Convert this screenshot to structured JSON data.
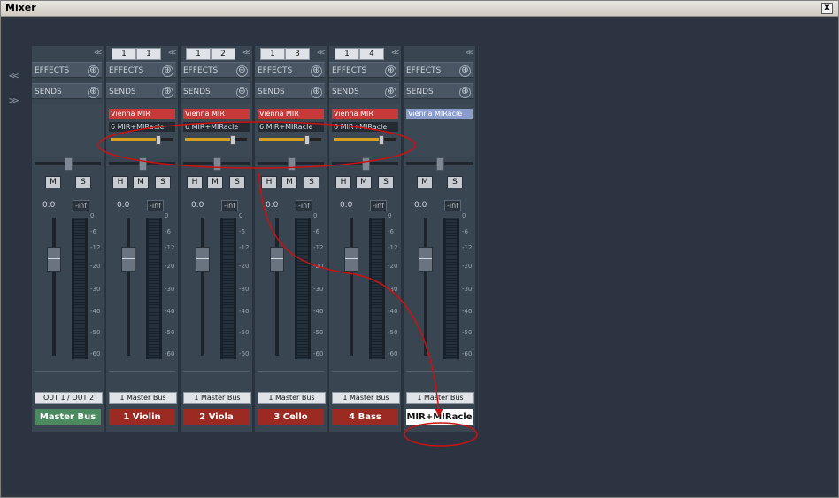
{
  "window": {
    "title": "Mixer",
    "close_label": "x"
  },
  "nav": {
    "collapse_left": "<<",
    "expand_right": ">>"
  },
  "labels": {
    "effects": "EFFECTS",
    "sends": "SENDS",
    "plus": "⊕",
    "collapse": "<<"
  },
  "buttons": {
    "h": "H",
    "m": "M",
    "s": "S"
  },
  "meter_ticks": [
    "0",
    "-6",
    "-12",
    "-20",
    "-30",
    "-40",
    "-50",
    "-60"
  ],
  "strips": [
    {
      "name": "Master Bus",
      "color": "#4a8a5e",
      "io": [],
      "volume": "0.0",
      "peak": "-inf",
      "route": "OUT 1 / OUT 2",
      "inserts": [],
      "has_h": false,
      "send_level": null
    },
    {
      "name": "1 Violin",
      "color": "#9a2a22",
      "io": [
        "1",
        "1"
      ],
      "volume": "0.0",
      "peak": "-inf",
      "route": "1 Master Bus",
      "inserts": [
        {
          "label": "Vienna MIR",
          "style": "red"
        },
        {
          "label": "6 MIR+MIRacle",
          "style": "dark"
        }
      ],
      "has_h": true,
      "send_level": 0.75
    },
    {
      "name": "2 Viola",
      "color": "#9a2a22",
      "io": [
        "1",
        "2"
      ],
      "volume": "0.0",
      "peak": "-inf",
      "route": "1 Master Bus",
      "inserts": [
        {
          "label": "Vienna MIR",
          "style": "red"
        },
        {
          "label": "6 MIR+MIRacle",
          "style": "dark"
        }
      ],
      "has_h": true,
      "send_level": 0.75
    },
    {
      "name": "3 Cello",
      "color": "#9a2a22",
      "io": [
        "1",
        "3"
      ],
      "volume": "0.0",
      "peak": "-inf",
      "route": "1 Master Bus",
      "inserts": [
        {
          "label": "Vienna MIR",
          "style": "red"
        },
        {
          "label": "6 MIR+MIRacle",
          "style": "dark"
        }
      ],
      "has_h": true,
      "send_level": 0.75
    },
    {
      "name": "4 Bass",
      "color": "#9a2a22",
      "io": [
        "1",
        "4"
      ],
      "volume": "0.0",
      "peak": "-inf",
      "route": "1 Master Bus",
      "inserts": [
        {
          "label": "Vienna MIR",
          "style": "red"
        },
        {
          "label": "6 MIR+MIRacle",
          "style": "dark"
        }
      ],
      "has_h": true,
      "send_level": 0.75
    },
    {
      "name": "MIR+MIRacle",
      "color": "#ffffff",
      "io": [],
      "volume": "0.0",
      "peak": "-inf",
      "route": "1 Master Bus",
      "inserts": [
        {
          "label": "Vienna MIRacle",
          "style": "blue"
        }
      ],
      "has_h": false,
      "send_level": null
    }
  ],
  "annotation": {
    "color": "#cc1111"
  }
}
